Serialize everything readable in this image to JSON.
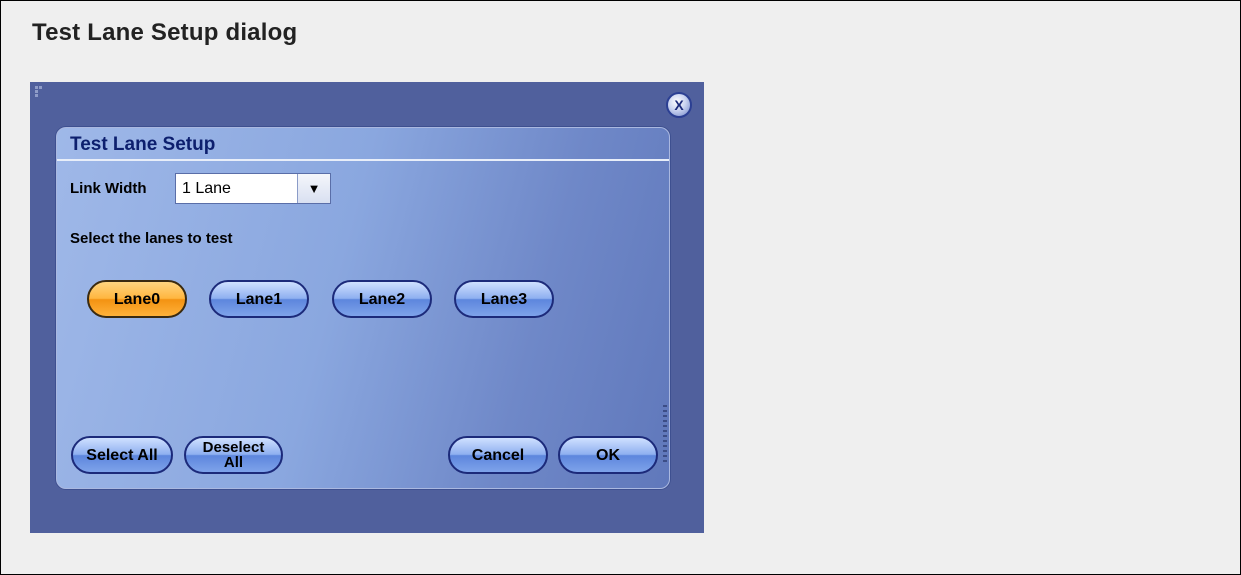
{
  "caption": "Test Lane Setup dialog",
  "dialog": {
    "close_label": "X",
    "title": "Test Lane Setup",
    "link_width": {
      "label": "Link Width",
      "value": "1 Lane",
      "arrow": "▼"
    },
    "select_prompt": "Select the lanes to test",
    "lanes": [
      {
        "label": "Lane0",
        "selected": true
      },
      {
        "label": "Lane1",
        "selected": false
      },
      {
        "label": "Lane2",
        "selected": false
      },
      {
        "label": "Lane3",
        "selected": false
      }
    ],
    "buttons": {
      "select_all": "Select All",
      "deselect_all_line1": "Deselect",
      "deselect_all_line2": "All",
      "cancel": "Cancel",
      "ok": "OK"
    }
  },
  "colors": {
    "background_blue": "#50609d",
    "selected_lane": "#f39212",
    "unselected_lane": "#5d86dd",
    "title_text": "#0d1f6e"
  }
}
